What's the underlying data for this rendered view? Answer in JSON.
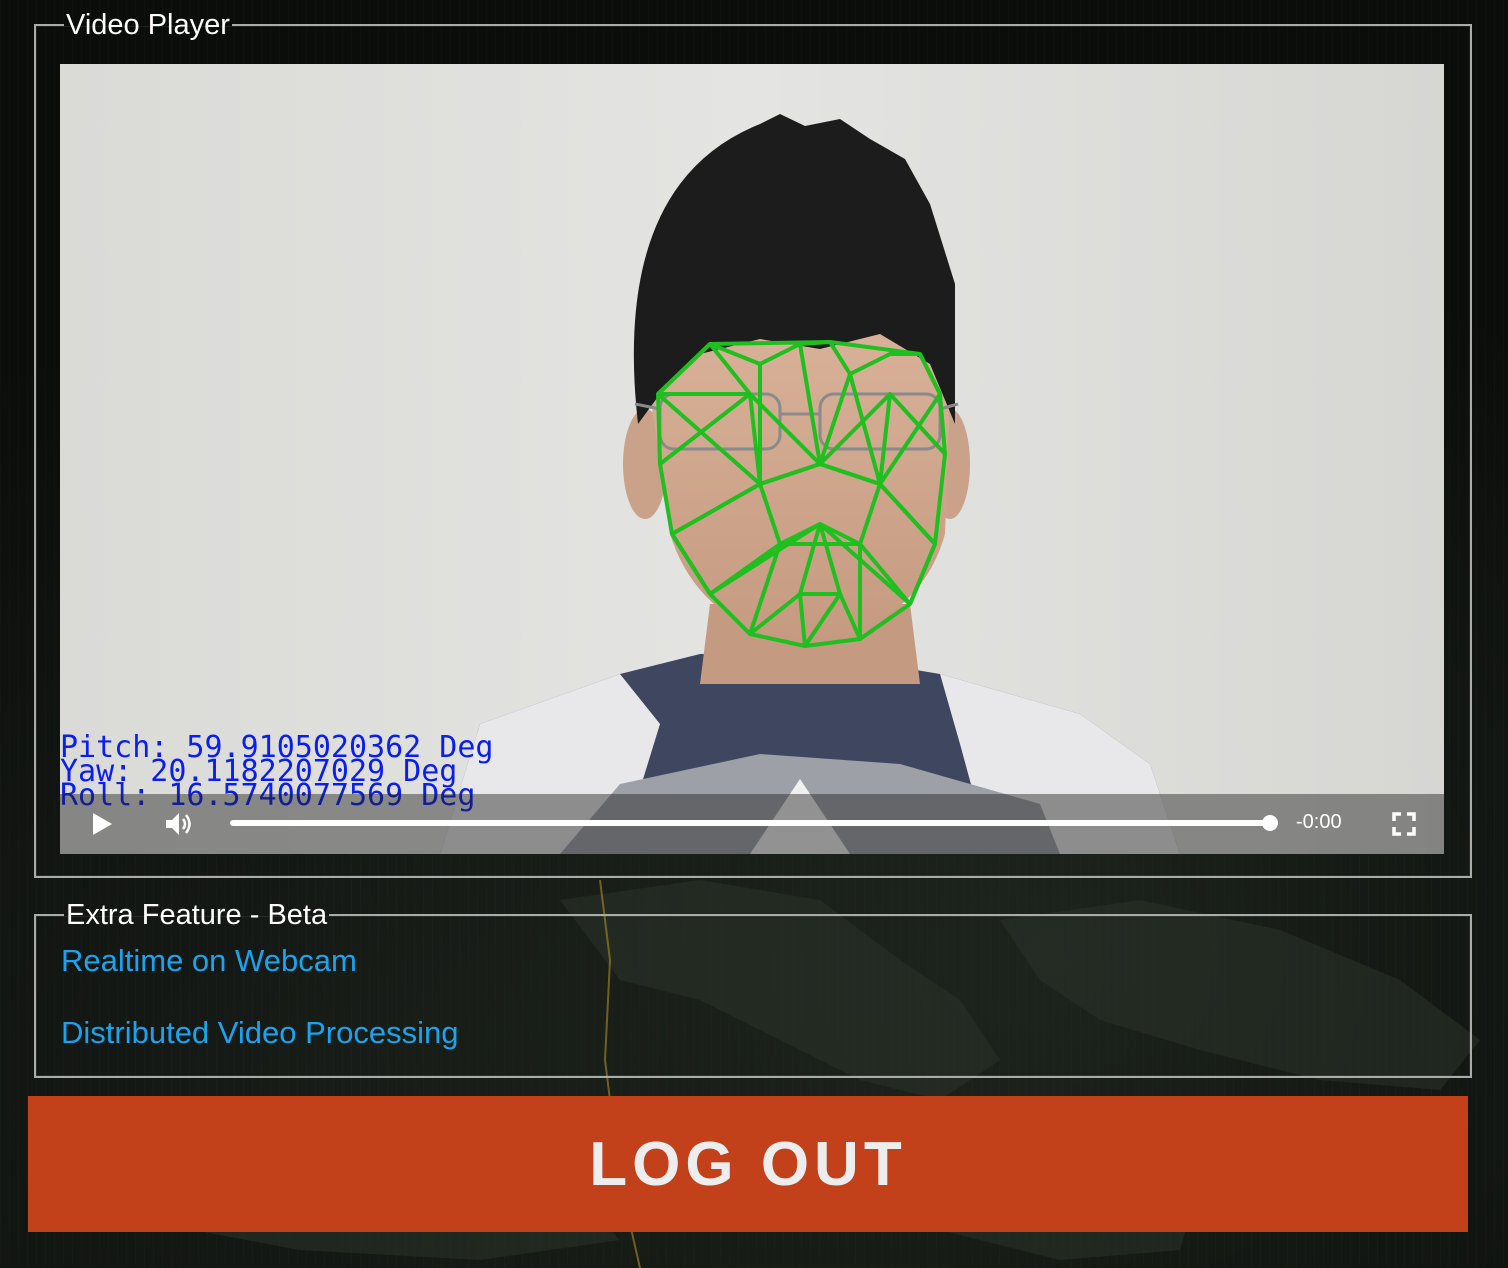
{
  "video_panel": {
    "legend": "Video Player",
    "hud": {
      "pitch": "Pitch: 59.9105020362 Deg",
      "yaw": "Yaw: 20.1182207029 Deg",
      "roll": "Roll: 16.5740077569 Deg",
      "color": "#0a1ef0"
    },
    "controls": {
      "play_icon": "play-icon",
      "volume_icon": "volume-icon",
      "fullscreen_icon": "fullscreen-icon",
      "time": "-0:00"
    },
    "mesh_color": "#1fbf1f"
  },
  "extra_panel": {
    "legend": "Extra Feature - Beta",
    "links": [
      {
        "label": "Realtime on Webcam"
      },
      {
        "label": "Distributed Video Processing"
      }
    ],
    "link_color": "#1aa3ee"
  },
  "logout_button": {
    "label": "LOG OUT",
    "color": "#c2401a"
  }
}
